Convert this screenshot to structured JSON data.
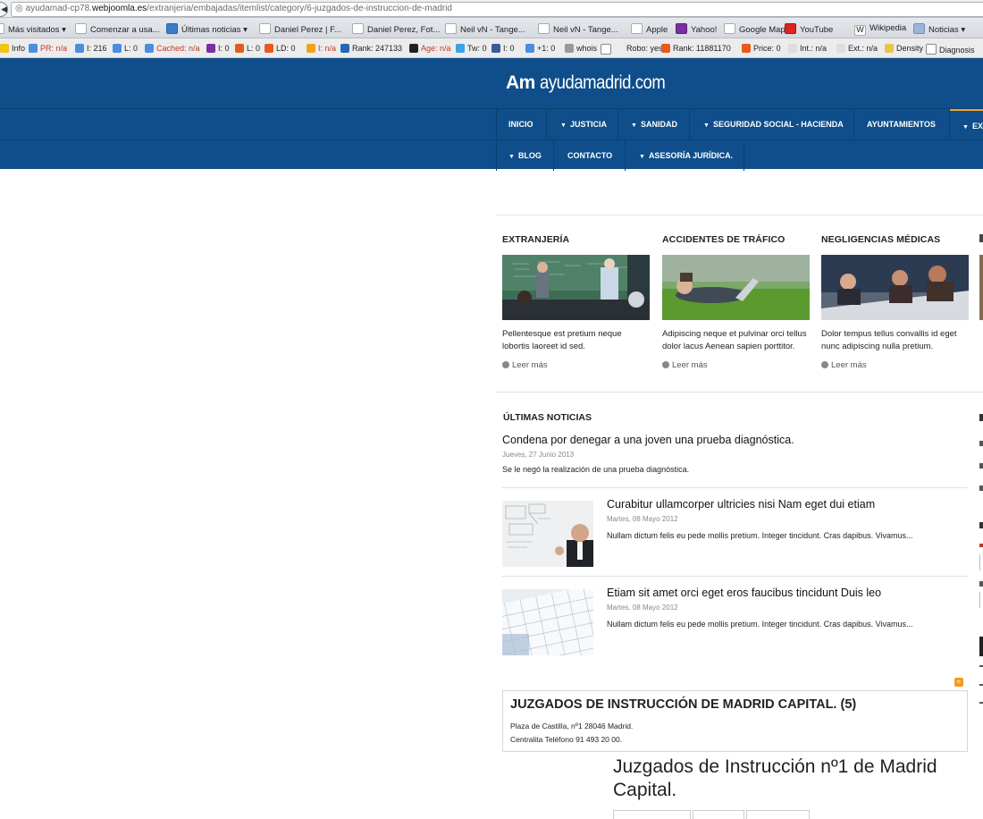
{
  "browser": {
    "url_prefix": "ayudamad-cp78.",
    "url_domain": "webjoomla.es",
    "url_path": "/extranjeria/embajadas/itemlist/category/6-juzgados-de-instruccion-de-madrid",
    "bookmarks": [
      "Más visitados ▾",
      "Comenzar a usa...",
      "Últimas noticias ▾",
      "Daniel Perez | F...",
      "Daniel Perez, Fot...",
      "Neil vN - Tange...",
      "Neil vN - Tange...",
      "Apple",
      "Yahoo!",
      "Google Maps",
      "YouTube",
      "Wikipedia",
      "Noticias ▾"
    ],
    "seo": [
      "Info",
      "PR: n/a",
      "I: 216",
      "L: 0",
      "Cached: n/a",
      "I: 0",
      "L: 0",
      "LD: 0",
      "I: n/a",
      "Rank: 247133",
      "Age: n/a",
      "Tw: 0",
      "I: 0",
      "+1: 0",
      "whois",
      "Robo: yes",
      "Rank: 11881170",
      "Price: 0",
      "Int.: n/a",
      "Ext.: n/a",
      "Density",
      "Diagnosis"
    ]
  },
  "site": {
    "logo_am": "Am",
    "logo_domain": "ayudamadrid.com",
    "nav_row1": [
      "INICIO",
      "JUSTICIA",
      "SANIDAD",
      "SEGURIDAD SOCIAL - HACIENDA",
      "AYUNTAMIENTOS",
      "EXT"
    ],
    "nav_row2": [
      "BLOG",
      "CONTACTO",
      "ASESORÍA JURÍDICA."
    ]
  },
  "categories": [
    {
      "title": "EXTRANJERÍA",
      "text1": "Pellentesque est pretium neque",
      "text2": "lobortis laoreet id sed.",
      "more": "Leer más"
    },
    {
      "title": "ACCIDENTES DE TRÁFICO",
      "text1": "Adipiscing neque et pulvinar orci tellus",
      "text2": "dolor lacus Aenean sapien porttitor.",
      "more": "Leer más"
    },
    {
      "title": "NEGLIGENCIAS MÉDICAS",
      "text1": "Dolor tempus tellus convallis id eget",
      "text2": "nunc adipiscing nulla pretium.",
      "more": "Leer más"
    }
  ],
  "news": {
    "section_title": "ÚLTIMAS NOTICIAS",
    "items": [
      {
        "headline": "Condena por denegar a una joven una prueba diagnóstica.",
        "date": "Jueves, 27 Junio 2013",
        "summary": "Se le negó la realización de una prueba diagnóstica."
      },
      {
        "headline": "Curabitur ullamcorper ultricies nisi Nam eget dui etiam",
        "date": "Martes, 08 Mayo 2012",
        "summary": "Nullam dictum felis eu pede mollis pretium. Integer tincidunt. Cras dapibus. Vivamus..."
      },
      {
        "headline": "Etiam sit amet orci eget eros faucibus tincidunt Duis leo",
        "date": "Martes, 08 Mayo 2012",
        "summary": "Nullam dictum felis eu pede mollis pretium. Integer tincidunt. Cras dapibus. Vivamus..."
      }
    ]
  },
  "category_box": {
    "title": "JUZGADOS DE INSTRUCCIÓN DE MADRID CAPITAL. (5)",
    "line1": "Plaza de Castilla, nº1 28046 Madrid.",
    "line2": "Centralita Teléfono 91 493 20 00."
  },
  "article": {
    "title": "Juzgados de Instrucción nº1 de Madrid Capital."
  },
  "colors": {
    "header_blue": "#0f4e8a",
    "accent_orange": "#f0a531"
  }
}
